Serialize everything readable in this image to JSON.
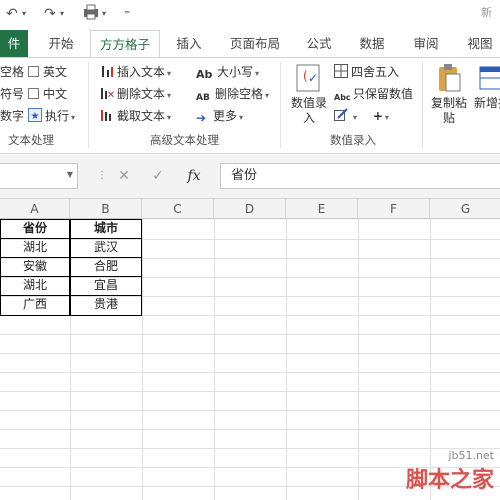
{
  "quick_access": {
    "undo": "↶",
    "redo": "↷",
    "title": "新"
  },
  "tabs": [
    {
      "label": "件"
    },
    {
      "label": "开始"
    },
    {
      "label": "方方格子"
    },
    {
      "label": "插入"
    },
    {
      "label": "页面布局"
    },
    {
      "label": "公式"
    },
    {
      "label": "数据"
    },
    {
      "label": "审阅"
    },
    {
      "label": "视图"
    }
  ],
  "ribbon": {
    "text_group": {
      "items": [
        "空格",
        "符号",
        "数字"
      ],
      "checks": [
        "英文",
        "中文"
      ],
      "execute": "执行",
      "label": "文本处理"
    },
    "advanced_group": {
      "items": [
        "插入文本",
        "删除文本",
        "截取文本",
        "大小写",
        "删除空格",
        "更多"
      ],
      "label": "高级文本处理"
    },
    "entry_group": {
      "big_button": "数值录入",
      "round": "四舍五入",
      "keep_value": "只保留数值",
      "label": "数值录入"
    },
    "paste_group": {
      "copy_paste": "复制粘贴",
      "new_add": "新增插"
    }
  },
  "formula_bar": {
    "cancel": "✕",
    "confirm": "✓",
    "fx": "fx",
    "value": "省份"
  },
  "columns": [
    "A",
    "B",
    "C",
    "D",
    "E",
    "F",
    "G"
  ],
  "table": {
    "headers": [
      "省份",
      "城市"
    ],
    "rows": [
      [
        "湖北",
        "武汉"
      ],
      [
        "安徽",
        "合肥"
      ],
      [
        "湖北",
        "宜昌"
      ],
      [
        "广西",
        "贵港"
      ]
    ]
  },
  "watermark": {
    "url": "jb51.net",
    "brand": "脚本之家"
  }
}
